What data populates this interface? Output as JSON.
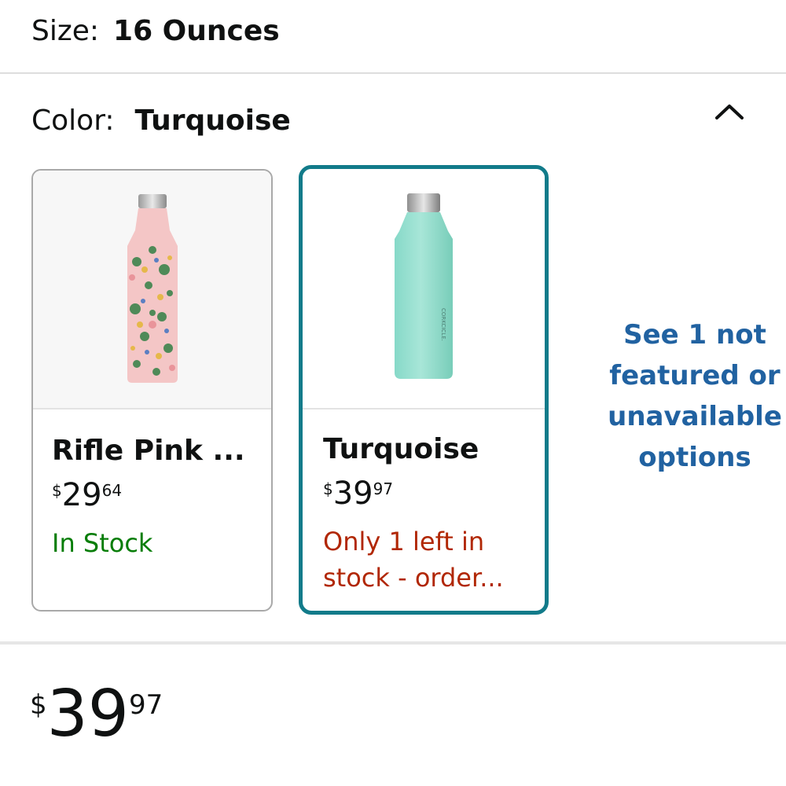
{
  "size": {
    "label": "Size:",
    "value": "16 Ounces"
  },
  "color": {
    "label": "Color:",
    "value": "Turquoise",
    "collapse_icon": "chevron-up-icon"
  },
  "swatches": [
    {
      "name": "Rifle Pink ...",
      "price_symbol": "$",
      "price_whole": "29",
      "price_fraction": "64",
      "stock": "In Stock",
      "stock_color": "#067d07"
    },
    {
      "name": "Turquoise",
      "price_symbol": "$",
      "price_whole": "39",
      "price_fraction": "97",
      "stock_line1": "Only 1 left in",
      "stock_line2": "stock - order...",
      "stock_color": "#b12704",
      "bottle_brand": "CORKCICLE."
    }
  ],
  "see_more": {
    "line1": "See 1 not",
    "line2": "featured or",
    "line3": "unavailable",
    "line4": "options"
  },
  "price": {
    "symbol": "$",
    "whole": "39",
    "fraction": "97"
  },
  "colors": {
    "selected_border": "#127b8a",
    "link": "#2162a1",
    "in_stock": "#067d07",
    "low_stock": "#b12704"
  }
}
